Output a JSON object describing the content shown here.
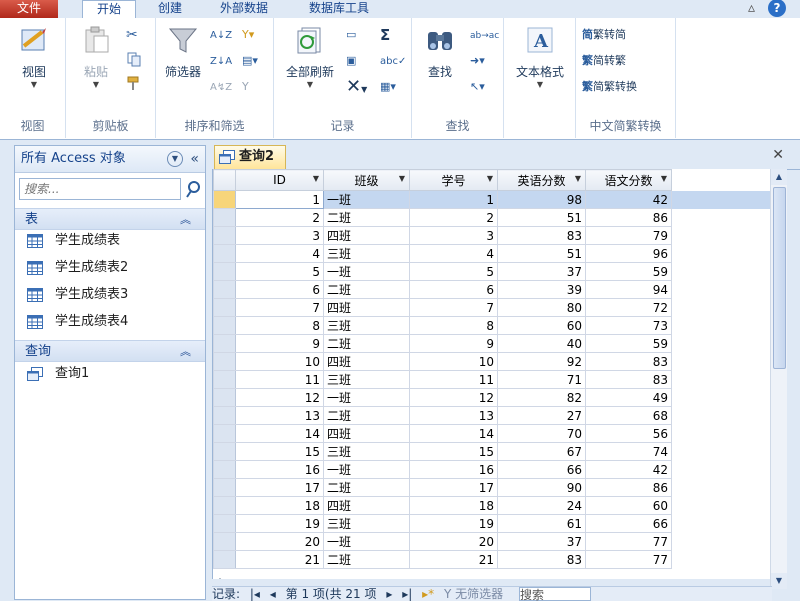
{
  "tabs": {
    "file": "文件",
    "home": "开始",
    "create": "创建",
    "external": "外部数据",
    "dbtools": "数据库工具"
  },
  "window": {
    "minimize": "▵",
    "help": "?"
  },
  "ribbon": {
    "groups": {
      "view": {
        "label": "视图",
        "view_btn": "视图"
      },
      "clipboard": {
        "label": "剪贴板",
        "paste_btn": "粘贴"
      },
      "sortfilter": {
        "label": "排序和筛选",
        "filter_btn": "筛选器"
      },
      "records": {
        "label": "记录",
        "refresh_btn": "全部刷新",
        "sum_btn": "Σ"
      },
      "find": {
        "label": "查找",
        "find_btn": "查找"
      },
      "textformat": {
        "label": "",
        "format_btn": "文本格式"
      },
      "chinese": {
        "label": "中文简繁转换",
        "t2s": "繁转简",
        "s2t": "简转繁",
        "convert": "简繁转换"
      }
    }
  },
  "nav": {
    "title": "所有 Access 对象",
    "search_placeholder": "搜索...",
    "sections": [
      {
        "title": "表",
        "items": [
          "学生成绩表",
          "学生成绩表2",
          "学生成绩表3",
          "学生成绩表4"
        ]
      },
      {
        "title": "查询",
        "items": [
          "查询1"
        ]
      }
    ]
  },
  "document": {
    "tab": "查询2",
    "columns": [
      "ID",
      "班级",
      "学号",
      "英语分数",
      "语文分数"
    ],
    "rows": [
      [
        1,
        "一班",
        1,
        98,
        42
      ],
      [
        2,
        "二班",
        2,
        51,
        86
      ],
      [
        3,
        "四班",
        3,
        83,
        79
      ],
      [
        4,
        "三班",
        4,
        51,
        96
      ],
      [
        5,
        "一班",
        5,
        37,
        59
      ],
      [
        6,
        "二班",
        6,
        39,
        94
      ],
      [
        7,
        "四班",
        7,
        80,
        72
      ],
      [
        8,
        "三班",
        8,
        60,
        73
      ],
      [
        9,
        "二班",
        9,
        40,
        59
      ],
      [
        10,
        "四班",
        10,
        92,
        83
      ],
      [
        11,
        "三班",
        11,
        71,
        83
      ],
      [
        12,
        "一班",
        12,
        82,
        49
      ],
      [
        13,
        "二班",
        13,
        27,
        68
      ],
      [
        14,
        "四班",
        14,
        70,
        56
      ],
      [
        15,
        "三班",
        15,
        67,
        74
      ],
      [
        16,
        "一班",
        16,
        66,
        42
      ],
      [
        17,
        "二班",
        17,
        90,
        86
      ],
      [
        18,
        "四班",
        18,
        24,
        60
      ],
      [
        19,
        "三班",
        19,
        61,
        66
      ],
      [
        20,
        "一班",
        20,
        37,
        77
      ],
      [
        21,
        "二班",
        21,
        83,
        77
      ]
    ],
    "new_row_marker": "*"
  },
  "record_nav": {
    "label": "记录:",
    "position": "第 1 项(共 21 项",
    "filter": "无筛选器",
    "search": "搜索"
  }
}
